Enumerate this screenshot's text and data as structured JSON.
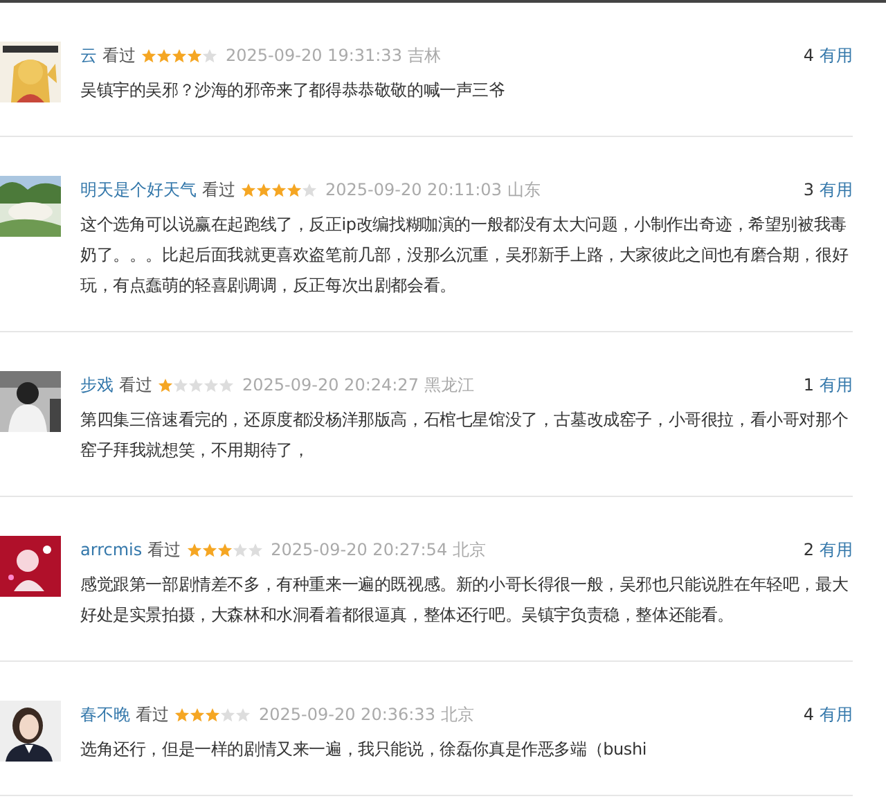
{
  "comments": [
    {
      "user": "云",
      "status": "看过",
      "stars": 4,
      "time": "2025-09-20 19:31:33",
      "location": "吉林",
      "votes": "4",
      "vote_label": "有用",
      "text": "吴镇宇的吴邪？沙海的邪帝来了都得恭恭敬敬的喊一声三爷"
    },
    {
      "user": "明天是个好天气",
      "status": "看过",
      "stars": 4,
      "time": "2025-09-20 20:11:03",
      "location": "山东",
      "votes": "3",
      "vote_label": "有用",
      "text": "这个选角可以说赢在起跑线了，反正ip改编找糊咖演的一般都没有太大问题，小制作出奇迹，希望别被我毒奶了。。。比起后面我就更喜欢盗笔前几部，没那么沉重，吴邪新手上路，大家彼此之间也有磨合期，很好玩，有点蠢萌的轻喜剧调调，反正每次出剧都会看。"
    },
    {
      "user": "步戏",
      "status": "看过",
      "stars": 1,
      "time": "2025-09-20 20:24:27",
      "location": "黑龙江",
      "votes": "1",
      "vote_label": "有用",
      "text": "第四集三倍速看完的，还原度都没杨洋那版高，石棺七星馆没了，古墓改成窑子，小哥很拉，看小哥对那个窑子拜我就想笑，不用期待了，"
    },
    {
      "user": "arrcmis",
      "status": "看过",
      "stars": 3,
      "time": "2025-09-20 20:27:54",
      "location": "北京",
      "votes": "2",
      "vote_label": "有用",
      "text": "感觉跟第一部剧情差不多，有种重来一遍的既视感。新的小哥长得很一般，吴邪也只能说胜在年轻吧，最大好处是实景拍摄，大森林和水洞看着都很逼真，整体还行吧。吴镇宇负责稳，整体还能看。"
    },
    {
      "user": "春不晚",
      "status": "看过",
      "stars": 3,
      "time": "2025-09-20 20:36:33",
      "location": "北京",
      "votes": "4",
      "vote_label": "有用",
      "text": "选角还行，但是一样的剧情又来一遍，我只能说，徐磊你真是作恶多端（bushi"
    }
  ]
}
